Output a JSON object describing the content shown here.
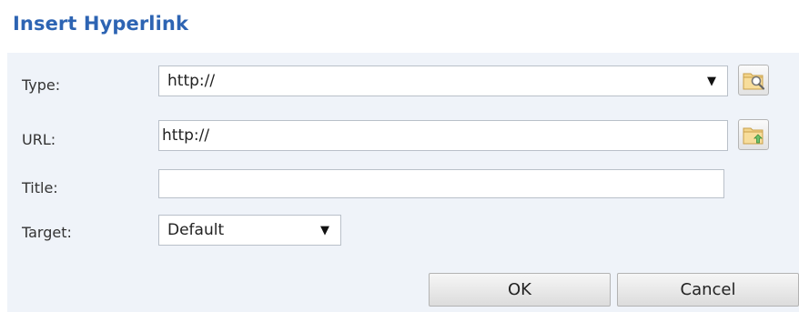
{
  "dialog": {
    "title": "Insert Hyperlink"
  },
  "form": {
    "type": {
      "label": "Type:",
      "value": "http://",
      "icon": "browse-folder-icon"
    },
    "url": {
      "label": "URL:",
      "value": "http://",
      "icon": "upload-folder-icon"
    },
    "title": {
      "label": "Title:",
      "value": ""
    },
    "target": {
      "label": "Target:",
      "value": "Default"
    }
  },
  "buttons": {
    "ok": "OK",
    "cancel": "Cancel"
  },
  "dropdown_arrow": "▼",
  "colors": {
    "title": "#2d64b3",
    "panel_background": "#eff3f9"
  }
}
